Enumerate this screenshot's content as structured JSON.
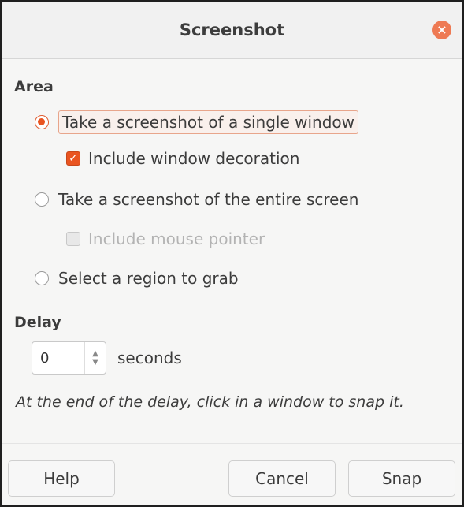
{
  "window": {
    "title": "Screenshot",
    "close_icon": "close-icon"
  },
  "area": {
    "label": "Area",
    "options": [
      {
        "label": "Take a screenshot of a single window",
        "selected": true
      },
      {
        "label": "Take a screenshot of the entire screen",
        "selected": false
      },
      {
        "label": "Select a region to grab",
        "selected": false
      }
    ],
    "include_window_decoration": {
      "label": "Include window decoration",
      "checked": true,
      "enabled": true
    },
    "include_mouse_pointer": {
      "label": "Include mouse pointer",
      "checked": false,
      "enabled": false
    }
  },
  "delay": {
    "label": "Delay",
    "value": "0",
    "unit": "seconds",
    "hint": "At the end of the delay, click in a window to snap it."
  },
  "buttons": {
    "help": "Help",
    "cancel": "Cancel",
    "snap": "Snap"
  },
  "colors": {
    "accent": "#e95420",
    "close": "#ee7a54"
  }
}
